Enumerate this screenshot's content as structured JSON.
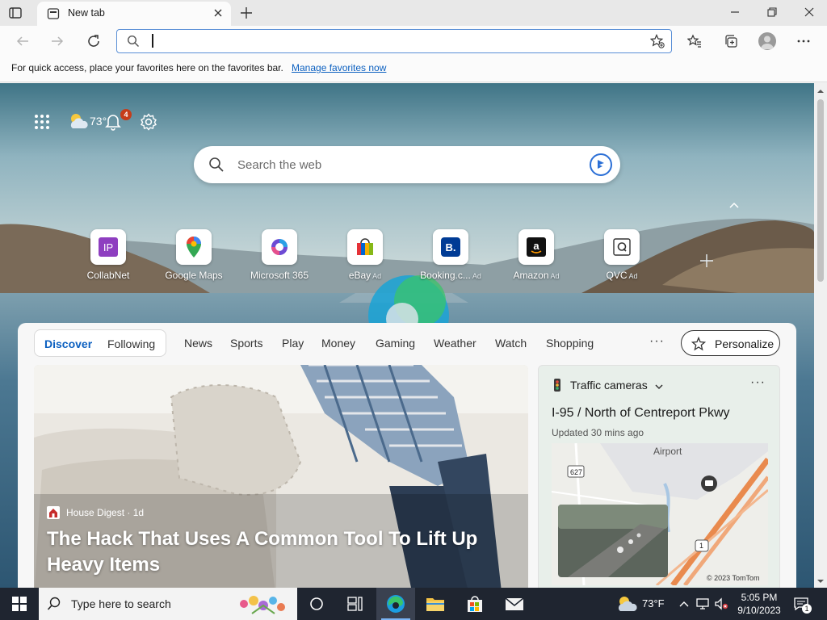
{
  "browser": {
    "tab_title": "New tab",
    "address_value": "",
    "favorites_bar_message": "For quick access, place your favorites here on the favorites bar.",
    "favorites_bar_link": "Manage favorites now"
  },
  "ntp": {
    "weather_temp": "73°",
    "notification_count": "4",
    "search_placeholder": "Search the web",
    "quick_links": [
      {
        "label": "CollabNet",
        "ad": ""
      },
      {
        "label": "Google Maps",
        "ad": ""
      },
      {
        "label": "Microsoft 365",
        "ad": ""
      },
      {
        "label": "eBay",
        "ad": "Ad"
      },
      {
        "label": "Booking.c...",
        "ad": "Ad"
      },
      {
        "label": "Amazon",
        "ad": "Ad"
      },
      {
        "label": "QVC",
        "ad": "Ad"
      }
    ]
  },
  "feed": {
    "primary_tabs": [
      "Discover",
      "Following"
    ],
    "categories": [
      "News",
      "Sports",
      "Play",
      "Money",
      "Gaming",
      "Weather",
      "Watch",
      "Shopping"
    ],
    "more": "···",
    "personalize_label": "Personalize",
    "hero": {
      "source": "House Digest · 1d",
      "title": "The Hack That Uses A Common Tool To Lift Up Heavy Items"
    },
    "traffic": {
      "title": "Traffic cameras",
      "road": "I-95 / North of Centreport Pkwy",
      "updated": "Updated 30 mins ago",
      "map_label": "Airport",
      "map_copyright": "© 2023 TomTom",
      "route_shield": "627",
      "route_shield2": "1"
    }
  },
  "taskbar": {
    "search_placeholder": "Type here to search",
    "weather_temp": "73°F",
    "time": "5:05 PM",
    "date": "9/10/2023",
    "notification_count": "1"
  },
  "colors": {
    "accent": "#0c60c0",
    "taskbar": "#1f2530",
    "notification_badge": "#c63d1a"
  }
}
